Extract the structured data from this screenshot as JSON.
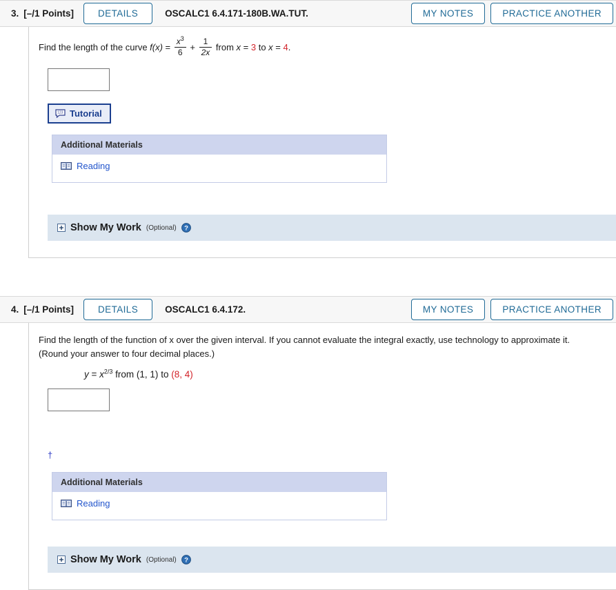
{
  "questions": [
    {
      "number": "3.",
      "points": "[–/1 Points]",
      "details_label": "DETAILS",
      "title": "OSCALC1 6.4.171-180B.WA.TUT.",
      "my_notes_label": "MY NOTES",
      "practice_another_label": "PRACTICE ANOTHER",
      "prompt": {
        "lead": "Find the length of the curve ",
        "fn": "f(x)",
        "equals": " = ",
        "frac1_num": "x",
        "frac1_num_exp": "3",
        "frac1_den": "6",
        "plus": " + ",
        "frac2_num": "1",
        "frac2_den": "2x",
        "from_word": " from ",
        "var1": "x",
        "eq1": " = ",
        "lower": "3",
        "to_word": " to ",
        "var2": "x",
        "eq2": " = ",
        "upper": "4",
        "period": "."
      },
      "answer_value": "",
      "answer_placeholder": "",
      "tutorial_label": "Tutorial",
      "additional_materials_header": "Additional Materials",
      "reading_label": "Reading",
      "show_my_work_label": "Show My Work",
      "show_my_work_optional": "(Optional)",
      "has_tutorial": true,
      "has_dagger": false,
      "dagger_symbol": ""
    },
    {
      "number": "4.",
      "points": "[–/1 Points]",
      "details_label": "DETAILS",
      "title": "OSCALC1 6.4.172.",
      "my_notes_label": "MY NOTES",
      "practice_another_label": "PRACTICE ANOTHER",
      "prompt": {
        "line1": "Find the length of the function of x over the given interval. If you cannot evaluate the integral exactly, use technology to approximate it.",
        "line2": "(Round your answer to four decimal places.)"
      },
      "equation": {
        "y": "y",
        "equals": " = ",
        "base": "x",
        "exp": "2/3",
        "from_word": " from ",
        "point1": "(1, 1)",
        "to_word": " to ",
        "point2": "(8, 4)"
      },
      "answer_value": "",
      "answer_placeholder": "",
      "tutorial_label": "",
      "additional_materials_header": "Additional Materials",
      "reading_label": "Reading",
      "show_my_work_label": "Show My Work",
      "show_my_work_optional": "(Optional)",
      "has_tutorial": false,
      "has_dagger": true,
      "dagger_symbol": "†"
    }
  ],
  "icons": {
    "tutorial": "tutorial-speech-bubble-icon",
    "reading": "open-book-icon",
    "expand": "plus-box-expand-icon",
    "help": "question-mark-help-icon"
  },
  "colors": {
    "accent_blue": "#1f6a96",
    "link_blue": "#2255cc",
    "red_value": "#d2232a",
    "header_bg": "#f7f7f7",
    "materials_header_bg": "#ced5ee",
    "show_work_bg": "#dbe5ef",
    "tutorial_border": "#1b3f8f",
    "dagger_blue": "#2b39c4"
  }
}
